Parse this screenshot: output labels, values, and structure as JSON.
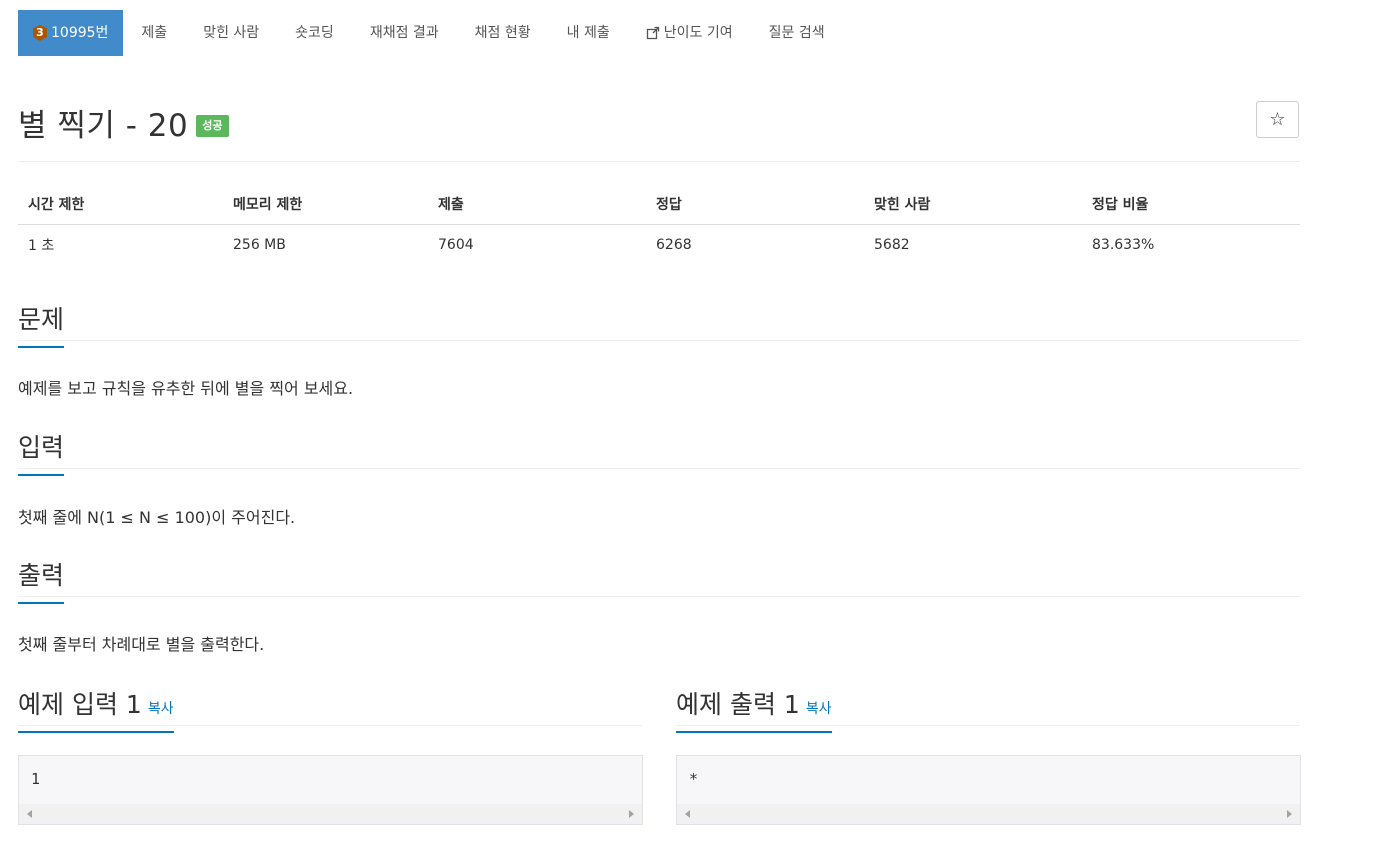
{
  "nav": {
    "problem_tier": "3",
    "problem_id": "10995번",
    "items": [
      "제출",
      "맞힌 사람",
      "숏코딩",
      "재채점 결과",
      "채점 현황",
      "내 제출",
      "난이도 기여",
      "질문 검색"
    ]
  },
  "header": {
    "title": "별 찍기 - 20",
    "status": "성공",
    "star_icon": "☆"
  },
  "info": {
    "headers": [
      "시간 제한",
      "메모리 제한",
      "제출",
      "정답",
      "맞힌 사람",
      "정답 비율"
    ],
    "values": [
      "1 초",
      "256 MB",
      "7604",
      "6268",
      "5682",
      "83.633%"
    ]
  },
  "sections": {
    "problem": {
      "title": "문제",
      "text": "예제를 보고 규칙을 유추한 뒤에 별을 찍어 보세요."
    },
    "input": {
      "title": "입력",
      "text": "첫째 줄에 N(1 ≤ N ≤ 100)이 주어진다."
    },
    "output": {
      "title": "출력",
      "text": "첫째 줄부터 차례대로 별을 출력한다."
    }
  },
  "samples": {
    "input_title": "예제 입력 1",
    "output_title": "예제 출력 1",
    "copy_label": "복사",
    "input_value": "1",
    "output_value": "*"
  },
  "colors": {
    "active_tab": "#428bca",
    "success_badge": "#5cb85c",
    "link": "#0076c0",
    "tier_badge": "#ad5600"
  }
}
